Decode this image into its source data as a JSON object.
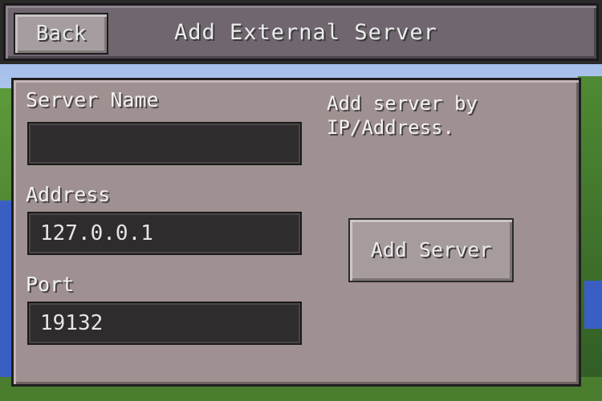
{
  "header": {
    "back_label": "Back",
    "title": "Add External Server"
  },
  "form": {
    "server_name": {
      "label": "Server Name",
      "value": ""
    },
    "address": {
      "label": "Address",
      "value": "127.0.0.1"
    },
    "port": {
      "label": "Port",
      "value": "19132"
    }
  },
  "hint": "Add server by IP/Address.",
  "add_button_label": "Add Server",
  "colors": {
    "panel": "#9f9191",
    "field": "#2f2c2d",
    "header": "#6f6670",
    "button": "#a69c9d"
  }
}
